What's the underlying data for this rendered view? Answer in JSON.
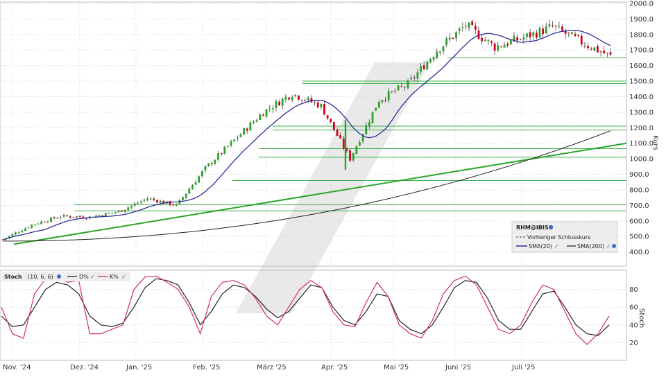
{
  "chart_data": [
    {
      "type": "candlestick",
      "symbol": "RHM@IBIS",
      "ylabel": "Kurs",
      "ylim": [
        300,
        2000
      ],
      "yticks": [
        400,
        500,
        600,
        700,
        800,
        900,
        1000,
        1100,
        1200,
        1300,
        1400,
        1500,
        1600,
        1700,
        1800,
        1900,
        2000
      ],
      "xticks": [
        "Nov. '24",
        "Dez. '24",
        "Jan. '25",
        "Feb. '25",
        "März '25",
        "Apr. '25",
        "Mai '25",
        "Juni '25",
        "Juli '25"
      ],
      "grid": true,
      "legend": {
        "position": "bottom-right",
        "title": "RHM@IBIS",
        "entries": [
          "Vorheriger Schlusskurs",
          "SMA(20)",
          "SMA(200)"
        ]
      },
      "colors": {
        "up": "#2ca02c",
        "down": "#d0021b",
        "sma20": "#2b2d9a",
        "sma200": "#222222",
        "trend": "#2aa52a",
        "level": "#3cb04a"
      },
      "support_resistance_levels": [
        1650,
        1500,
        1485,
        1210,
        1185,
        1065,
        1010,
        860,
        705,
        665
      ],
      "trendline": {
        "from": {
          "date": "Nov. '24",
          "value": 450
        },
        "to": {
          "date": "end",
          "value": 1100
        }
      },
      "price_path": [
        [
          "Nov. '24",
          480
        ],
        [
          "Dez. '24",
          575
        ],
        [
          "Dez. '24 mid",
          630
        ],
        [
          "Jan. '25",
          625
        ],
        [
          "Jan. '25 mid",
          660
        ],
        [
          "Feb. '25",
          745
        ],
        [
          "Feb. '25 mid",
          700
        ],
        [
          "Feb. '25 late",
          940
        ],
        [
          "März '25",
          1120
        ],
        [
          "März '25 mid",
          1300
        ],
        [
          "März '25 late",
          1420
        ],
        [
          "Apr. '25",
          1340
        ],
        [
          "Apr. '25 low",
          1000
        ],
        [
          "Apr. '25 late",
          1380
        ],
        [
          "Mai '25",
          1480
        ],
        [
          "Mai '25 mid",
          1700
        ],
        [
          "Juni '25",
          1860
        ],
        [
          "Juni '25 mid",
          1720
        ],
        [
          "Juli '25",
          1780
        ],
        [
          "Juli '25 mid",
          1850
        ],
        [
          "Aug. '25",
          1750
        ],
        [
          "last",
          1660
        ]
      ]
    },
    {
      "type": "line",
      "title": "Stoch",
      "params": "(10, 6, 6)",
      "ylabel": "Stoch",
      "ylim": [
        0,
        100
      ],
      "yticks": [
        20,
        40,
        60,
        80
      ],
      "series": [
        {
          "name": "D%",
          "color": "#222222",
          "values": [
            50,
            38,
            40,
            60,
            80,
            88,
            85,
            75,
            50,
            40,
            38,
            42,
            60,
            82,
            92,
            90,
            85,
            65,
            40,
            55,
            75,
            85,
            82,
            72,
            58,
            48,
            55,
            70,
            85,
            82,
            60,
            45,
            40,
            55,
            75,
            72,
            45,
            35,
            30,
            40,
            60,
            82,
            90,
            88,
            70,
            45,
            35,
            35,
            55,
            75,
            78,
            60,
            40,
            30,
            28,
            40
          ]
        },
        {
          "name": "K%",
          "color": "#d0325a",
          "values": [
            60,
            30,
            25,
            75,
            92,
            95,
            88,
            90,
            30,
            30,
            35,
            40,
            80,
            94,
            95,
            88,
            80,
            60,
            30,
            72,
            88,
            90,
            85,
            70,
            50,
            40,
            60,
            80,
            90,
            82,
            55,
            40,
            38,
            65,
            88,
            72,
            40,
            30,
            25,
            45,
            75,
            90,
            95,
            85,
            60,
            35,
            30,
            40,
            65,
            85,
            80,
            55,
            30,
            18,
            30,
            50
          ]
        }
      ]
    }
  ]
}
